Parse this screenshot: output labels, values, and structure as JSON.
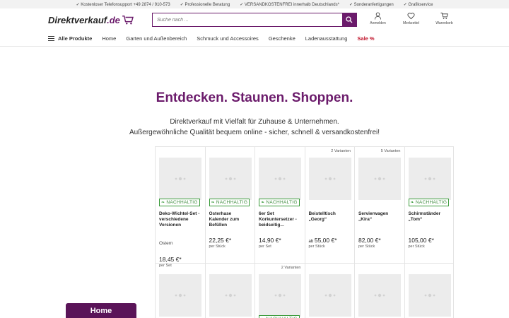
{
  "topbar": {
    "items": [
      "Kostenloser Telefonsupport +49 2874 / 910-573",
      "Professionelle Beratung",
      "VERSANDKOSTENFREI innerhalb Deutschlands*",
      "Sonderanfertigungen",
      "Grafikservice"
    ]
  },
  "header": {
    "logo_main": "Direktverkauf",
    "logo_tld": ".de",
    "search_placeholder": "Suche nach ...",
    "actions": [
      "Anmelden",
      "Merkzettel",
      "Warenkorb"
    ]
  },
  "nav": {
    "all_products": "Alle Produkte",
    "items": [
      "Home",
      "Garten und Außenbereich",
      "Schmuck und Accessoires",
      "Geschenke",
      "Ladenausstattung"
    ],
    "sale": "Sale %"
  },
  "hero": {
    "title": "Entdecken. Staunen. Shoppen.",
    "line1": "Direktverkauf mit Vielfalt für Zuhause & Unternehmen.",
    "line2": "Außergewöhnliche Qualität bequem online - sicher, schnell & versandkostenfrei!"
  },
  "badge_label": "NACHHALTIG",
  "products_row1": [
    {
      "variants": "",
      "badge": true,
      "name": "Deko-Wichtel-Set - verschiedene Versionen",
      "extra": "Ostern",
      "price_prefix": "",
      "price": "18,45 €*",
      "unit": "per Set"
    },
    {
      "variants": "",
      "badge": true,
      "name": "Osterhase Kalender zum Befüllen",
      "extra": "",
      "price_prefix": "",
      "price": "22,25 €*",
      "unit": "per Stück"
    },
    {
      "variants": "",
      "badge": true,
      "name": "6er Set Korkuntersetzer - beidseitig...",
      "extra": "",
      "price_prefix": "",
      "price": "14,90 €*",
      "unit": "per Set"
    },
    {
      "variants": "2 Varianten",
      "badge": false,
      "name": "Beistelltisch „Georg“",
      "extra": "",
      "price_prefix": "ab ",
      "price": "55,00 €*",
      "unit": "per Stück"
    },
    {
      "variants": "5 Varianten",
      "badge": false,
      "name": "Servierwagen „Kira“",
      "extra": "",
      "price_prefix": "",
      "price": "82,00 €*",
      "unit": "per Stück"
    },
    {
      "variants": "",
      "badge": true,
      "name": "Schirmständer „Tom“",
      "extra": "",
      "price_prefix": "",
      "price": "105,00 €*",
      "unit": "per Stück"
    }
  ],
  "products_row2": [
    {
      "variants": "",
      "badge": false
    },
    {
      "variants": "",
      "badge": false
    },
    {
      "variants": "2 Varianten",
      "badge": true
    },
    {
      "variants": "",
      "badge": false
    },
    {
      "variants": "",
      "badge": false
    },
    {
      "variants": "",
      "badge": false
    }
  ],
  "home_button": "Home",
  "colors": {
    "brand": "#6b1b6b",
    "sale": "#c0142b",
    "eco": "#3a9a3a"
  }
}
